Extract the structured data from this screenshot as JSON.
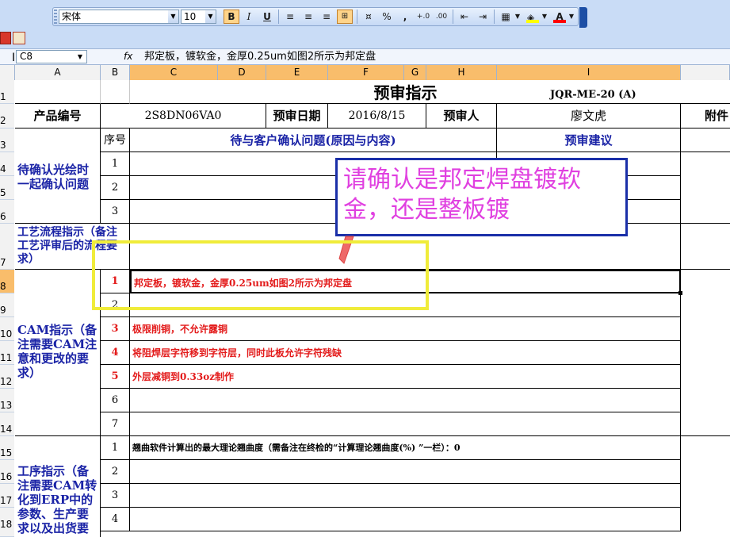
{
  "toolbar": {
    "font_name": "宋体",
    "font_size": "10",
    "bold": "B",
    "italic": "I",
    "underline": "U",
    "percent": "%",
    "comma": ",",
    "fill_color": "#ffff00",
    "font_color": "#ff0000"
  },
  "formula_bar": {
    "name_box": "C8",
    "fx": "fx",
    "content": "邦定板，镀软金，金厚0.25um如图2所示为邦定盘"
  },
  "columns": [
    "A",
    "B",
    "C",
    "D",
    "E",
    "F",
    "G",
    "H",
    "I"
  ],
  "rows": [
    "1",
    "2",
    "3",
    "4",
    "5",
    "6",
    "7",
    "8",
    "9",
    "10",
    "11",
    "12",
    "13",
    "14",
    "15",
    "16",
    "17",
    "18"
  ],
  "sheet": {
    "title": "预审指示",
    "doc_code": "JQR-ME-20 (A)",
    "product_label": "产品编号",
    "product_value": "2S8DN06VA0",
    "date_label": "预审日期",
    "date_value": "2016/8/15",
    "reviewer_label": "预审人",
    "reviewer_value": "廖文虎",
    "attachment_label": "附件",
    "seq_header": "序号",
    "issue_header": "待与客户确认问题(原因与内容)",
    "advice_header": "预审建议",
    "section_confirm": "待确认光绘时一起确认问题",
    "section_process": "工艺流程指示（备注工艺评审后的流程要求）",
    "section_cam": "CAM指示（备注需要CAM注意和更改的要求）",
    "section_procedure": "工序指示（备注需要CAM转化到ERP中的参数、生产要求以及出货要",
    "confirm_rows": [
      "1",
      "2",
      "3"
    ],
    "cam_rows": [
      {
        "n": "1",
        "text": "邦定板，镀软金，金厚0.25um如图2所示为邦定盘"
      },
      {
        "n": "2",
        "text": ""
      },
      {
        "n": "3",
        "text": "极限削铜，不允许露铜"
      },
      {
        "n": "4",
        "text": "将阻焊层字符移到字符层，同时此板允许字符残缺"
      },
      {
        "n": "5",
        "text": "外层减铜到0.33oz制作"
      },
      {
        "n": "6",
        "text": ""
      },
      {
        "n": "7",
        "text": ""
      }
    ],
    "procedure_rows": [
      {
        "n": "1",
        "text": "翘曲软件计算出的最大理论翘曲度（需备注在终检的“计算理论翘曲度(%) ”一栏）：0"
      },
      {
        "n": "2",
        "text": ""
      },
      {
        "n": "3",
        "text": ""
      },
      {
        "n": "4",
        "text": ""
      }
    ]
  },
  "callout": {
    "text": "请确认是邦定焊盘镀软金，还是整板镀",
    "border_color": "#1a2fa8",
    "text_color": "#e040e0",
    "highlight_color": "#f0ec3a"
  }
}
